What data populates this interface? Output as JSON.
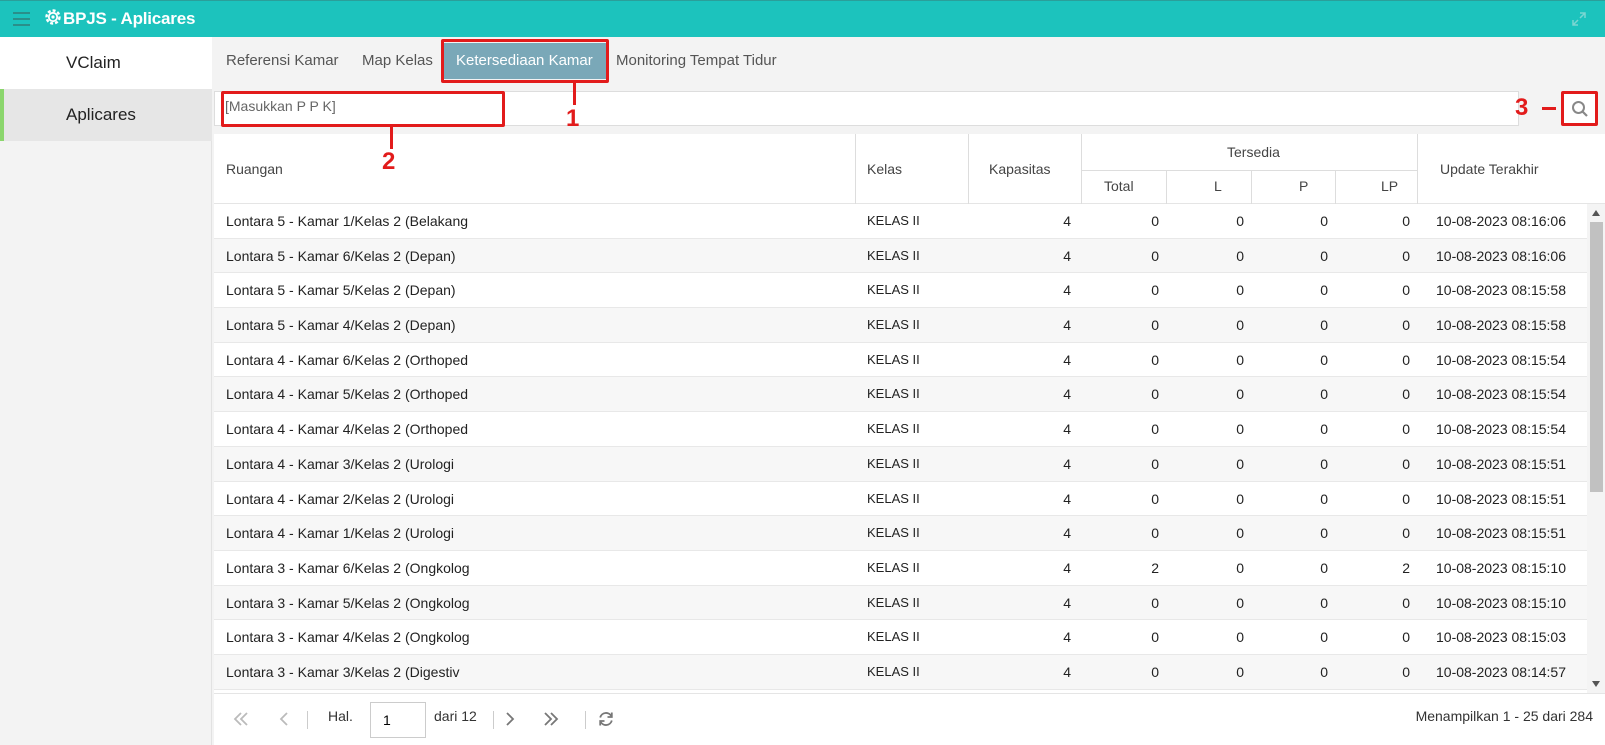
{
  "app": {
    "title": "BPJS - Aplicares"
  },
  "sidebar": {
    "items": [
      {
        "label": "VClaim"
      },
      {
        "label": "Aplicares"
      }
    ]
  },
  "tabs": [
    {
      "label": "Referensi Kamar"
    },
    {
      "label": "Map Kelas"
    },
    {
      "label": "Ketersediaan Kamar",
      "active": true
    },
    {
      "label": "Monitoring Tempat Tidur"
    }
  ],
  "search": {
    "placeholder": "[Masukkan P P K]",
    "value": ""
  },
  "callouts": [
    "1",
    "2",
    "3"
  ],
  "table": {
    "headers": {
      "ruangan": "Ruangan",
      "kelas": "Kelas",
      "kapasitas": "Kapasitas",
      "tersedia": "Tersedia",
      "total": "Total",
      "l": "L",
      "p": "P",
      "lp": "LP",
      "update": "Update Terakhir"
    },
    "rows": [
      {
        "ruangan": "Lontara 5 - Kamar 1/Kelas 2 (Belakang",
        "kelas": "KELAS II",
        "kapasitas": "4",
        "total": "0",
        "l": "0",
        "p": "0",
        "lp": "0",
        "update": "10-08-2023 08:16:06"
      },
      {
        "ruangan": "Lontara 5 - Kamar 6/Kelas 2 (Depan)",
        "kelas": "KELAS II",
        "kapasitas": "4",
        "total": "0",
        "l": "0",
        "p": "0",
        "lp": "0",
        "update": "10-08-2023 08:16:06"
      },
      {
        "ruangan": "Lontara 5 - Kamar 5/Kelas 2 (Depan)",
        "kelas": "KELAS II",
        "kapasitas": "4",
        "total": "0",
        "l": "0",
        "p": "0",
        "lp": "0",
        "update": "10-08-2023 08:15:58"
      },
      {
        "ruangan": "Lontara 5 - Kamar 4/Kelas 2 (Depan)",
        "kelas": "KELAS II",
        "kapasitas": "4",
        "total": "0",
        "l": "0",
        "p": "0",
        "lp": "0",
        "update": "10-08-2023 08:15:58"
      },
      {
        "ruangan": "Lontara 4 - Kamar 6/Kelas 2 (Orthoped",
        "kelas": "KELAS II",
        "kapasitas": "4",
        "total": "0",
        "l": "0",
        "p": "0",
        "lp": "0",
        "update": "10-08-2023 08:15:54"
      },
      {
        "ruangan": "Lontara 4 - Kamar 5/Kelas 2 (Orthoped",
        "kelas": "KELAS II",
        "kapasitas": "4",
        "total": "0",
        "l": "0",
        "p": "0",
        "lp": "0",
        "update": "10-08-2023 08:15:54"
      },
      {
        "ruangan": "Lontara 4 - Kamar 4/Kelas 2 (Orthoped",
        "kelas": "KELAS II",
        "kapasitas": "4",
        "total": "0",
        "l": "0",
        "p": "0",
        "lp": "0",
        "update": "10-08-2023 08:15:54"
      },
      {
        "ruangan": "Lontara 4 - Kamar 3/Kelas 2 (Urologi",
        "kelas": "KELAS II",
        "kapasitas": "4",
        "total": "0",
        "l": "0",
        "p": "0",
        "lp": "0",
        "update": "10-08-2023 08:15:51"
      },
      {
        "ruangan": "Lontara 4 - Kamar 2/Kelas 2 (Urologi",
        "kelas": "KELAS II",
        "kapasitas": "4",
        "total": "0",
        "l": "0",
        "p": "0",
        "lp": "0",
        "update": "10-08-2023 08:15:51"
      },
      {
        "ruangan": "Lontara 4 - Kamar 1/Kelas 2 (Urologi",
        "kelas": "KELAS II",
        "kapasitas": "4",
        "total": "0",
        "l": "0",
        "p": "0",
        "lp": "0",
        "update": "10-08-2023 08:15:51"
      },
      {
        "ruangan": "Lontara 3 - Kamar 6/Kelas 2 (Ongkolog",
        "kelas": "KELAS II",
        "kapasitas": "4",
        "total": "2",
        "l": "0",
        "p": "0",
        "lp": "2",
        "update": "10-08-2023 08:15:10"
      },
      {
        "ruangan": "Lontara 3 - Kamar 5/Kelas 2 (Ongkolog",
        "kelas": "KELAS II",
        "kapasitas": "4",
        "total": "0",
        "l": "0",
        "p": "0",
        "lp": "0",
        "update": "10-08-2023 08:15:10"
      },
      {
        "ruangan": "Lontara 3 - Kamar 4/Kelas 2 (Ongkolog",
        "kelas": "KELAS II",
        "kapasitas": "4",
        "total": "0",
        "l": "0",
        "p": "0",
        "lp": "0",
        "update": "10-08-2023 08:15:03"
      },
      {
        "ruangan": "Lontara 3 - Kamar 3/Kelas 2 (Digestiv",
        "kelas": "KELAS II",
        "kapasitas": "4",
        "total": "0",
        "l": "0",
        "p": "0",
        "lp": "0",
        "update": "10-08-2023 08:14:57"
      }
    ]
  },
  "pager": {
    "page_label": "Hal.",
    "page_value": "1",
    "of_label": "dari 12",
    "summary": "Menampilkan 1 - 25 dari 284"
  },
  "colors": {
    "topbar": "#1cc3bd",
    "active_tab": "#7aa8b8",
    "sidebar_accent": "#8bd66d",
    "annotation": "#e21b1b"
  },
  "icons": [
    "menu-icon",
    "gear-logo-icon",
    "expand-icon",
    "search-icon",
    "first-page-icon",
    "prev-page-icon",
    "next-page-icon",
    "last-page-icon",
    "refresh-icon"
  ]
}
